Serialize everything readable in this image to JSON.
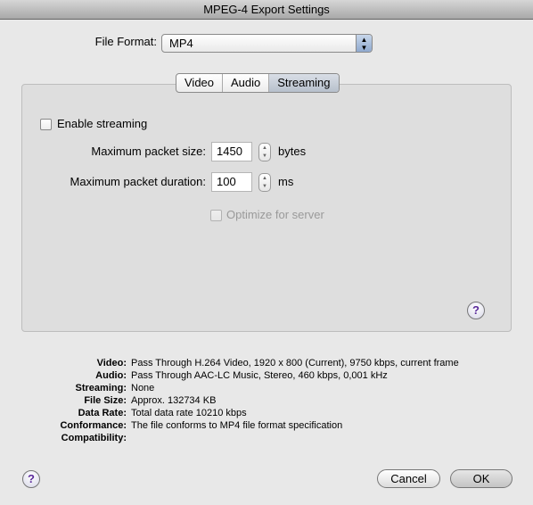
{
  "window": {
    "title": "MPEG-4 Export Settings"
  },
  "file_format": {
    "label": "File Format:",
    "value": "MP4"
  },
  "tabs": [
    {
      "label": "Video"
    },
    {
      "label": "Audio"
    },
    {
      "label": "Streaming",
      "selected": true
    }
  ],
  "streaming": {
    "enable_label": "Enable streaming",
    "enable_checked": false,
    "packet_size_label": "Maximum packet size:",
    "packet_size_value": "1450",
    "packet_size_unit": "bytes",
    "packet_duration_label": "Maximum packet duration:",
    "packet_duration_value": "100",
    "packet_duration_unit": "ms",
    "optimize_label": "Optimize for server",
    "optimize_checked": false,
    "optimize_enabled": false
  },
  "summary": [
    {
      "key": "Video:",
      "value": "Pass Through H.264 Video, 1920 x 800 (Current), 9750 kbps, current frame"
    },
    {
      "key": "Audio:",
      "value": "Pass Through AAC-LC Music, Stereo, 460 kbps, 0,001 kHz"
    },
    {
      "key": "Streaming:",
      "value": "None"
    },
    {
      "key": "File Size:",
      "value": "Approx. 132734 KB"
    },
    {
      "key": "Data Rate:",
      "value": "Total data rate 10210 kbps"
    },
    {
      "key": "Conformance:",
      "value": "The file conforms to MP4 file format specification"
    },
    {
      "key": "Compatibility:",
      "value": ""
    }
  ],
  "help_symbol": "?",
  "buttons": {
    "cancel": "Cancel",
    "ok": "OK"
  }
}
